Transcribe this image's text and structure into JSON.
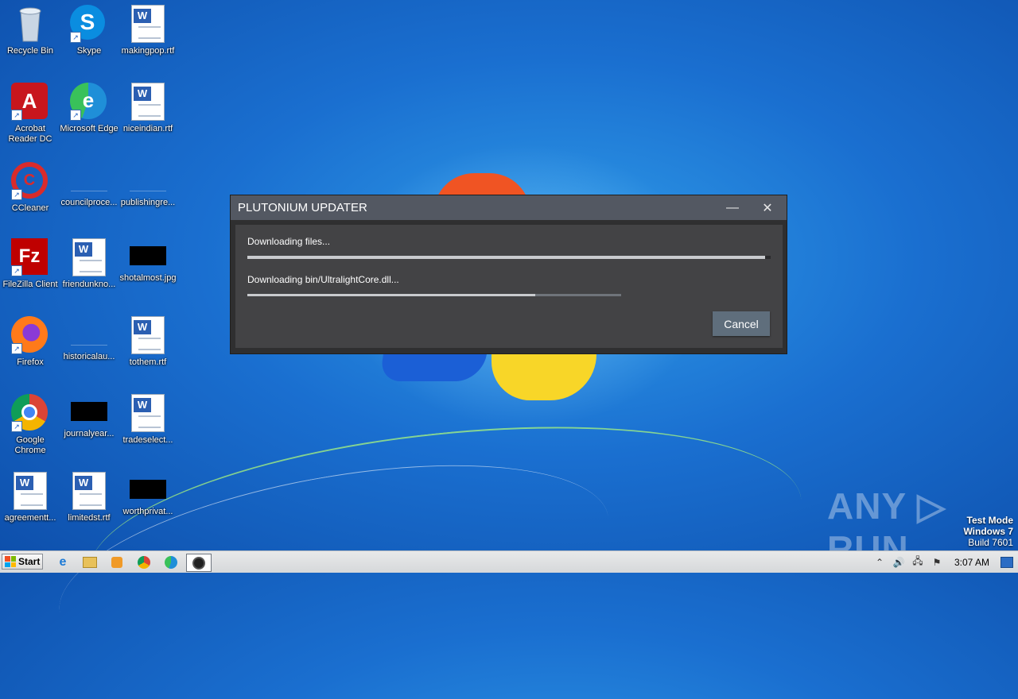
{
  "desktop": {
    "icons": [
      {
        "label": "Recycle Bin",
        "glyph": "🗑"
      },
      {
        "label": "Skype",
        "glyph": "S"
      },
      {
        "label": "makingpop.rtf"
      },
      {
        "label": "Acrobat Reader DC",
        "glyph": "A"
      },
      {
        "label": "Microsoft Edge",
        "glyph": "e"
      },
      {
        "label": "niceindian.rtf"
      },
      {
        "label": "CCleaner",
        "glyph": "C"
      },
      {
        "label": "councilproce..."
      },
      {
        "label": "publishingre..."
      },
      {
        "label": "FileZilla Client",
        "glyph": "Fz"
      },
      {
        "label": "friendunkno..."
      },
      {
        "label": "shotalmost.jpg"
      },
      {
        "label": "Firefox",
        "glyph": "🦊"
      },
      {
        "label": "historicalau..."
      },
      {
        "label": "tothem.rtf"
      },
      {
        "label": "Google Chrome",
        "glyph": "◉"
      },
      {
        "label": "journalyear..."
      },
      {
        "label": "tradeselect..."
      },
      {
        "label": "agreementt..."
      },
      {
        "label": "limitedst.rtf"
      },
      {
        "label": "worthprivat..."
      }
    ]
  },
  "dialog": {
    "title": "PLUTONIUM UPDATER",
    "minimize_glyph": "—",
    "close_glyph": "✕",
    "status_main": "Downloading files...",
    "status_file": "Downloading bin/UltralightCore.dll...",
    "overall_progress": 0.99,
    "file_progress": 0.77,
    "cancel_label": "Cancel"
  },
  "watermark": {
    "text": "ANY ▷ RUN"
  },
  "os_info": {
    "line1": "Test Mode",
    "line2": "Windows 7",
    "line3": "Build 7601"
  },
  "taskbar": {
    "start_label": "Start",
    "clock": "3:07 AM",
    "tray_expand": "⌃"
  },
  "colors": {
    "dialog_title": "#535862",
    "dialog_body": "#434345",
    "cancel_button": "#5f6e7c"
  }
}
